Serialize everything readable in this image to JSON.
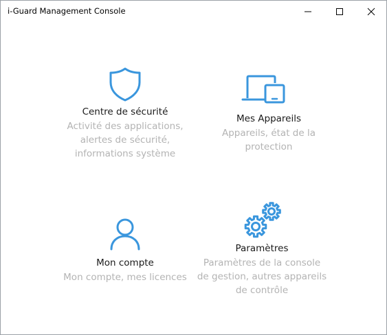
{
  "window": {
    "title": "i-Guard Management Console",
    "controls": {
      "minimize_icon": "minimize-icon",
      "maximize_icon": "maximize-icon",
      "close_icon": "close-icon"
    }
  },
  "theme": {
    "accent": "#3a96dd",
    "title_text": "#1a1a1a",
    "desc_text": "#b3b3b3"
  },
  "tiles": [
    {
      "icon": "shield-icon",
      "title": "Centre de sécurité",
      "desc_lines": [
        "Activité des applications,",
        "alertes de sécurité,",
        "informations système"
      ]
    },
    {
      "icon": "devices-icon",
      "title": "Mes Appareils",
      "desc_lines": [
        "Appareils, état de la",
        "protection"
      ]
    },
    {
      "icon": "person-icon",
      "title": "Mon compte",
      "desc_lines": [
        "Mon compte, mes licences"
      ]
    },
    {
      "icon": "gears-icon",
      "title": "Paramètres",
      "desc_lines": [
        "Paramètres de la console",
        "de gestion, autres appareils",
        "de contrôle"
      ]
    }
  ]
}
